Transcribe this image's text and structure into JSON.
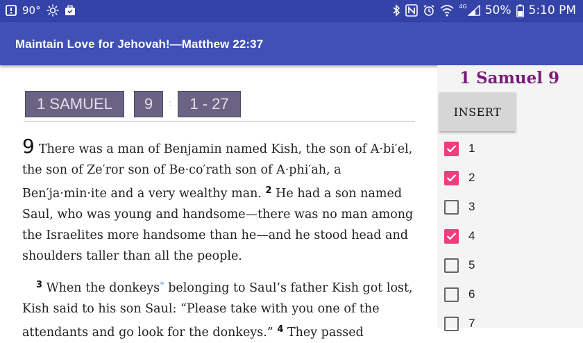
{
  "status_bar": {
    "temperature": "90°",
    "battery": "50%",
    "time": "5:10 PM",
    "network_label": "4G",
    "icons": [
      "alert-icon",
      "sun-icon",
      "briefcase-icon",
      "bluetooth-icon",
      "nfc-icon",
      "alarm-icon",
      "wifi-icon",
      "signal-icon",
      "battery-icon"
    ]
  },
  "app_bar": {
    "title": "Maintain Love for Jehovah!—Matthew 22:37"
  },
  "pickers": {
    "book": "1 SAMUEL",
    "chapter": "9",
    "separator": ":",
    "verses": "1 - 27"
  },
  "reading": {
    "chapter_number": "9",
    "v1": "There was a man of Benjamin named Kish, the son of A·bi′el, the son of Ze′ror son of Be·co′rath son of A·phi′ah, a Ben′ja·min·ite and a very wealthy man.",
    "v2_num": "2",
    "v2": "He had a son named Saul, who was young and handsome—there was no man among the Israelites more handsome than he—and he stood head and shoulders taller than all the people.",
    "v3_num": "3",
    "v3a": "When the donkeys",
    "footnote_mark": "*",
    "v3b": "belonging to Saul’s father Kish got lost, Kish said to his son Saul: “Please take with you one of the attendants and go look for the donkeys.”",
    "v4_num": "4",
    "v4": "They passed"
  },
  "sidebar": {
    "title": "1 Samuel 9",
    "insert_label": "INSERT",
    "verses": [
      {
        "label": "1",
        "checked": true
      },
      {
        "label": "2",
        "checked": true
      },
      {
        "label": "3",
        "checked": false
      },
      {
        "label": "4",
        "checked": true
      },
      {
        "label": "5",
        "checked": false
      },
      {
        "label": "6",
        "checked": false
      },
      {
        "label": "7",
        "checked": false
      }
    ]
  },
  "colors": {
    "status_bar": "#3443a8",
    "app_bar": "#4050b5",
    "accent": "#ef3d7d",
    "sidebar_title": "#7a1b7a",
    "picker": "#6b6383"
  }
}
